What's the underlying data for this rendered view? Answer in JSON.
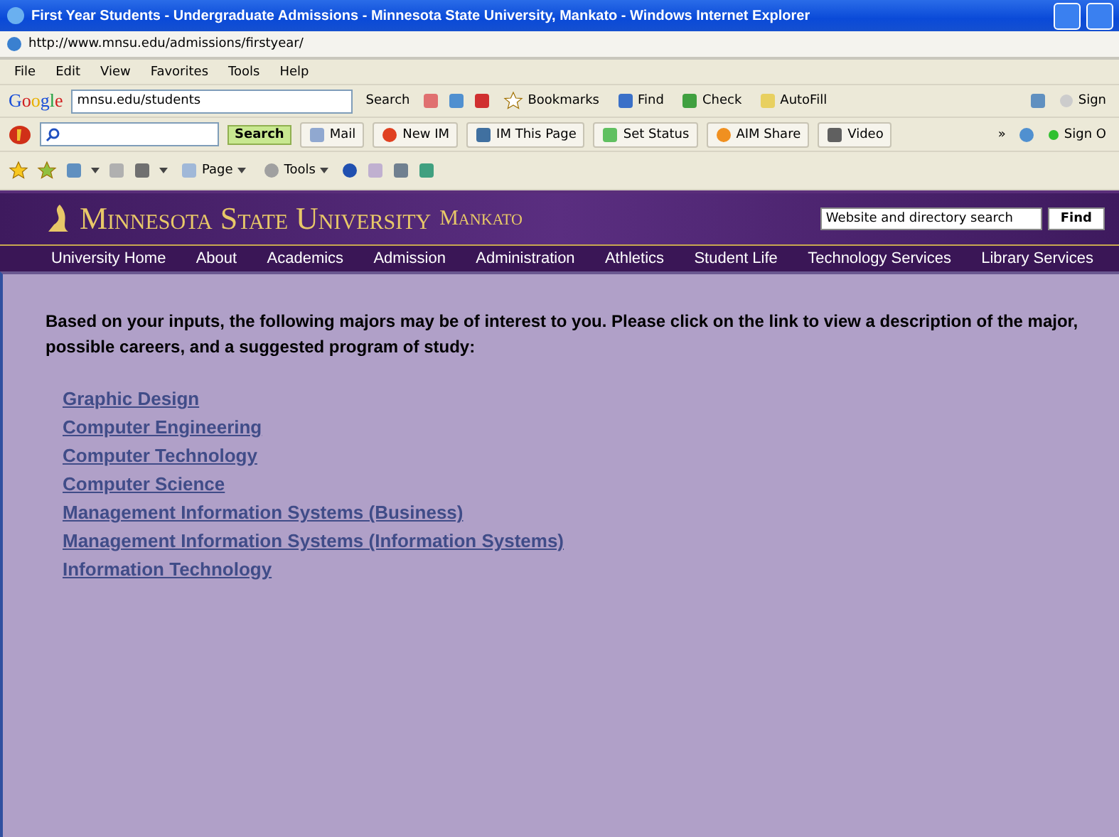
{
  "window": {
    "title": "First Year Students - Undergraduate Admissions - Minnesota State University, Mankato - Windows Internet Explorer",
    "address": "http://www.mnsu.edu/admissions/firstyear/"
  },
  "menu": [
    "File",
    "Edit",
    "View",
    "Favorites",
    "Tools",
    "Help"
  ],
  "google_toolbar": {
    "brand": "Google",
    "search_value": "mnsu.edu/students",
    "search_button": "Search",
    "buttons": [
      "Bookmarks",
      "Find",
      "Check",
      "AutoFill"
    ],
    "cut_label": "Sign"
  },
  "aim_toolbar": {
    "search_button": "Search",
    "buttons": [
      "Mail",
      "New IM",
      "IM This Page",
      "Set Status",
      "AIM Share",
      "Video"
    ],
    "overflow": "»",
    "cut_label": "Sign O"
  },
  "command_bar": {
    "buttons": [
      "Page",
      "Tools"
    ]
  },
  "site": {
    "name": "Minnesota State University",
    "sub": "Mankato",
    "search_placeholder": "Website and directory search",
    "find": "Find",
    "nav": [
      "University Home",
      "About",
      "Academics",
      "Admission",
      "Administration",
      "Athletics",
      "Student Life",
      "Technology Services",
      "Library Services"
    ]
  },
  "content": {
    "intro": "Based on your inputs, the following majors may be of interest to you. Please click on the link to view a description of the major, possible careers, and  a suggested program of study:",
    "majors": [
      "Graphic Design",
      "Computer Engineering",
      "Computer Technology",
      "Computer Science",
      "Management Information Systems (Business)",
      "Management Information Systems (Information Systems)",
      "Information Technology"
    ]
  }
}
